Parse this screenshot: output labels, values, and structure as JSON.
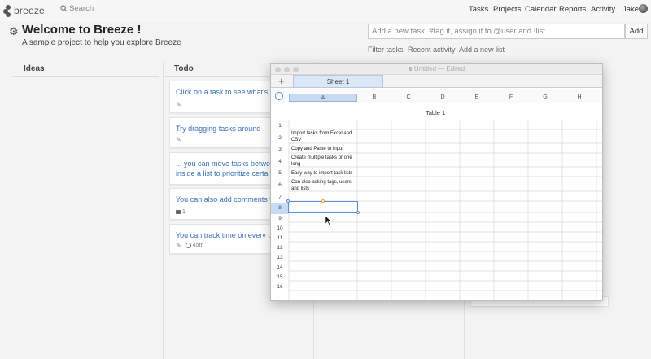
{
  "topbar": {
    "logo_text": "breeze",
    "search_placeholder": "Search",
    "nav": [
      "Tasks",
      "Projects",
      "Calendar",
      "Reports",
      "Activity"
    ],
    "user_name": "Jake"
  },
  "project": {
    "title": "Welcome to Breeze !",
    "subtitle": "A sample project to help you explore Breeze",
    "task_input_placeholder": "Add a new task, #tag it, assign it to @user and !list",
    "add_button": "Add",
    "subnav": [
      "Filter tasks",
      "Recent activity",
      "Add a new list"
    ]
  },
  "board": {
    "columns": [
      "Ideas",
      "Todo"
    ],
    "cards": [
      {
        "line1": "Click on a task to see what's be",
        "line2": "",
        "meta": ""
      },
      {
        "line1": "Try dragging tasks around",
        "line2": "",
        "meta": ""
      },
      {
        "line1": "... you can move tasks between",
        "line2": "inside a list to prioritize certain",
        "meta": ""
      },
      {
        "line1": "You can also add comments to",
        "line2": "",
        "meta": "1"
      },
      {
        "line1": "You can track time on every tas",
        "line2": "",
        "meta": "45m"
      }
    ]
  },
  "numbers_window": {
    "title": "Untitled",
    "status": "Edited",
    "sheet_tab": "Sheet 1",
    "column_headers": [
      "A",
      "B",
      "C",
      "D",
      "E",
      "F",
      "G",
      "H"
    ],
    "table_title": "Table 1",
    "rows": [
      "1",
      "2",
      "3",
      "4",
      "5",
      "6",
      "7",
      "8",
      "9",
      "10",
      "11",
      "12",
      "13",
      "14",
      "15",
      "16"
    ],
    "selected_row": "8",
    "cells": [
      {
        "row": "2",
        "text": "Import tasks from Excel and CSV"
      },
      {
        "row": "3",
        "text": "Copy and Paste to input"
      },
      {
        "row": "4",
        "text": "Create multiple tasks or one long"
      },
      {
        "row": "5",
        "text": "Easy way to import task lists"
      },
      {
        "row": "6",
        "text": "Can also asking tags, users and lists"
      }
    ]
  },
  "colors": {
    "link": "#3b6fb6",
    "selection": "#5a8fd6",
    "tab": "#dbe6f6"
  }
}
